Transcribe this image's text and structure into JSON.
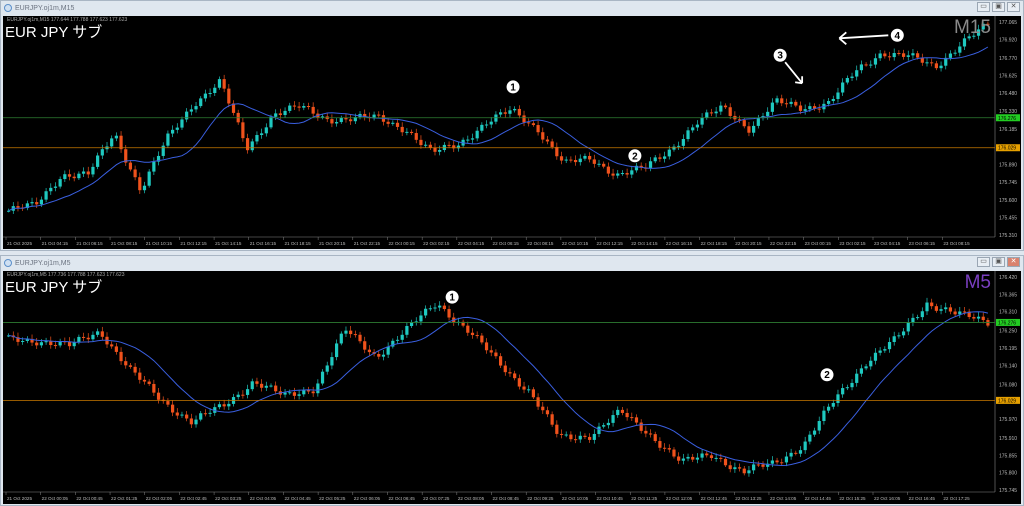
{
  "windows": [
    {
      "title": "EURJPY.oj1m,M15",
      "info": "EURJPY.oj1m,M15  177.644 177.788 177.623 177.623",
      "symbol": "EUR JPY  サブ",
      "timeframe": "M15",
      "timeframe_color": "#8a8a8a",
      "buttons": [
        "minimize",
        "restore",
        "close"
      ]
    },
    {
      "title": "EURJPY.oj1m,M5",
      "info": "EURJPY.oj1m,M5  177.736 177.788 177.623 177.623",
      "symbol": "EUR JPY  サブ",
      "timeframe": "M5",
      "timeframe_color": "#7a3fc0",
      "buttons": [
        "minimize",
        "restore",
        "close"
      ]
    }
  ],
  "colors": {
    "bull": "#1fc9c0",
    "bear": "#f0521c",
    "ma": "#3a5fe0",
    "green_line": "#2e7d32",
    "orange_line": "#c77800",
    "green_label": "#22cc22",
    "orange_label": "#e6a000"
  },
  "chart_data": [
    {
      "type": "candlestick",
      "timeframe": "M15",
      "ylim": [
        175.31,
        177.065
      ],
      "yticks": [
        "177.065",
        "176.920",
        "176.770",
        "176.625",
        "176.480",
        "176.330",
        "176.185",
        "175.890",
        "175.745",
        "175.600",
        "175.455",
        "175.310"
      ],
      "xticks": [
        "21 Oct 2025",
        "21 Oct 04:15",
        "21 Oct 06:15",
        "21 Oct 08:15",
        "21 Oct 10:15",
        "21 Oct 12:15",
        "21 Oct 14:15",
        "21 Oct 16:15",
        "21 Oct 18:15",
        "21 Oct 20:15",
        "21 Oct 22:15",
        "22 Oct 00:15",
        "22 Oct 02:15",
        "22 Oct 04:15",
        "22 Oct 06:15",
        "22 Oct 08:15",
        "22 Oct 10:15",
        "22 Oct 12:15",
        "22 Oct 14:15",
        "22 Oct 16:15",
        "22 Oct 18:15",
        "22 Oct 20:15",
        "22 Oct 22:15",
        "23 Oct 00:15",
        "23 Oct 02:15",
        "23 Oct 04:15",
        "23 Oct 06:15",
        "23 Oct 08:15",
        "23 Oct 10:15"
      ],
      "close_path": [
        175.51,
        175.55,
        175.81,
        175.8,
        176.15,
        175.68,
        176.1,
        176.4,
        176.57,
        176.02,
        176.31,
        176.36,
        176.27,
        176.27,
        176.27,
        176.19,
        175.98,
        176.06,
        176.23,
        176.33,
        176.19,
        175.89,
        175.94,
        175.81,
        175.85,
        176.02,
        176.23,
        176.36,
        176.19,
        176.4,
        176.36,
        176.4,
        176.65,
        176.82,
        176.78,
        176.69,
        176.9,
        177.03
      ],
      "levels": [
        {
          "name": "green",
          "value": 176.276,
          "label": "176.276"
        },
        {
          "name": "orange",
          "value": 176.029,
          "label": "176.029"
        }
      ],
      "annotations": [
        {
          "label": "1",
          "x_index": 0.515
        },
        {
          "label": "2",
          "x_index": 0.64
        },
        {
          "label": "3",
          "x_index": 0.79
        },
        {
          "label": "4",
          "x_index": 0.91
        }
      ]
    },
    {
      "type": "candlestick",
      "timeframe": "M5",
      "ylim": [
        175.745,
        176.42
      ],
      "yticks": [
        "176.420",
        "176.365",
        "176.310",
        "176.250",
        "176.195",
        "176.140",
        "176.080",
        "175.970",
        "175.910",
        "175.855",
        "175.800",
        "175.745"
      ],
      "xticks": [
        "21 Oct 2025",
        "22 Oct 00:05",
        "22 Oct 00:45",
        "22 Oct 01:25",
        "22 Oct 02:05",
        "22 Oct 02:45",
        "22 Oct 03:25",
        "22 Oct 04:05",
        "22 Oct 04:45",
        "22 Oct 05:25",
        "22 Oct 06:05",
        "22 Oct 06:45",
        "22 Oct 07:25",
        "22 Oct 08:05",
        "22 Oct 08:45",
        "22 Oct 09:25",
        "22 Oct 10:05",
        "22 Oct 10:45",
        "22 Oct 11:25",
        "22 Oct 12:05",
        "22 Oct 12:45",
        "22 Oct 13:25",
        "22 Oct 14:05",
        "22 Oct 14:45",
        "22 Oct 15:25",
        "22 Oct 16:05",
        "22 Oct 16:45",
        "22 Oct 17:25",
        "22 Oct 18:05"
      ],
      "close_path": [
        176.22,
        176.22,
        176.2,
        176.25,
        176.12,
        176.03,
        175.96,
        176.01,
        176.09,
        176.04,
        176.07,
        176.25,
        176.17,
        176.25,
        176.34,
        176.25,
        176.15,
        176.06,
        175.91,
        175.92,
        175.99,
        175.92,
        175.83,
        175.86,
        175.8,
        175.83,
        175.89,
        176.03,
        176.15,
        176.22,
        176.34,
        176.3,
        176.28
      ],
      "levels": [
        {
          "name": "green",
          "value": 176.276,
          "label": "176.276"
        },
        {
          "name": "orange",
          "value": 176.029,
          "label": "176.029"
        }
      ],
      "annotations": [
        {
          "label": "1",
          "x_index": 0.455
        },
        {
          "label": "2",
          "x_index": 0.835
        }
      ]
    }
  ]
}
